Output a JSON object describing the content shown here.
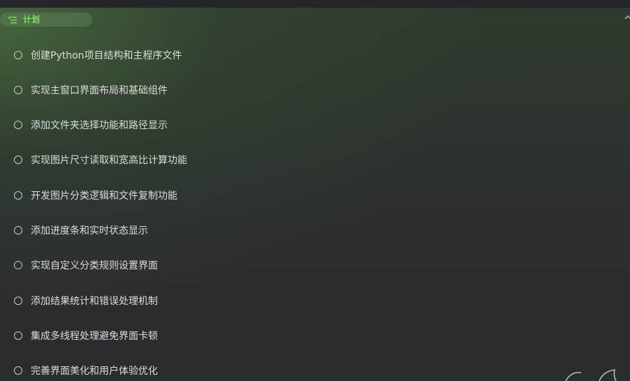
{
  "plan": {
    "title": "计划",
    "items": [
      {
        "label": "创建Python项目结构和主程序文件"
      },
      {
        "label": "实现主窗口界面布局和基础组件"
      },
      {
        "label": "添加文件夹选择功能和路径显示"
      },
      {
        "label": "实现图片尺寸读取和宽高比计算功能"
      },
      {
        "label": "开发图片分类逻辑和文件复制功能"
      },
      {
        "label": "添加进度条和实时状态显示"
      },
      {
        "label": "实现自定义分类规则设置界面"
      },
      {
        "label": "添加结果统计和错误处理机制"
      },
      {
        "label": "集成多线程处理避免界面卡顿"
      },
      {
        "label": "完善界面美化和用户体验优化"
      }
    ]
  },
  "colors": {
    "accent": "#7ee06a",
    "text": "#dcdedb",
    "background": "#2a2c2f"
  },
  "icons": {
    "header": "list-check-icon",
    "collapse": "chevron-up-icon",
    "item": "circle-outline-icon"
  }
}
